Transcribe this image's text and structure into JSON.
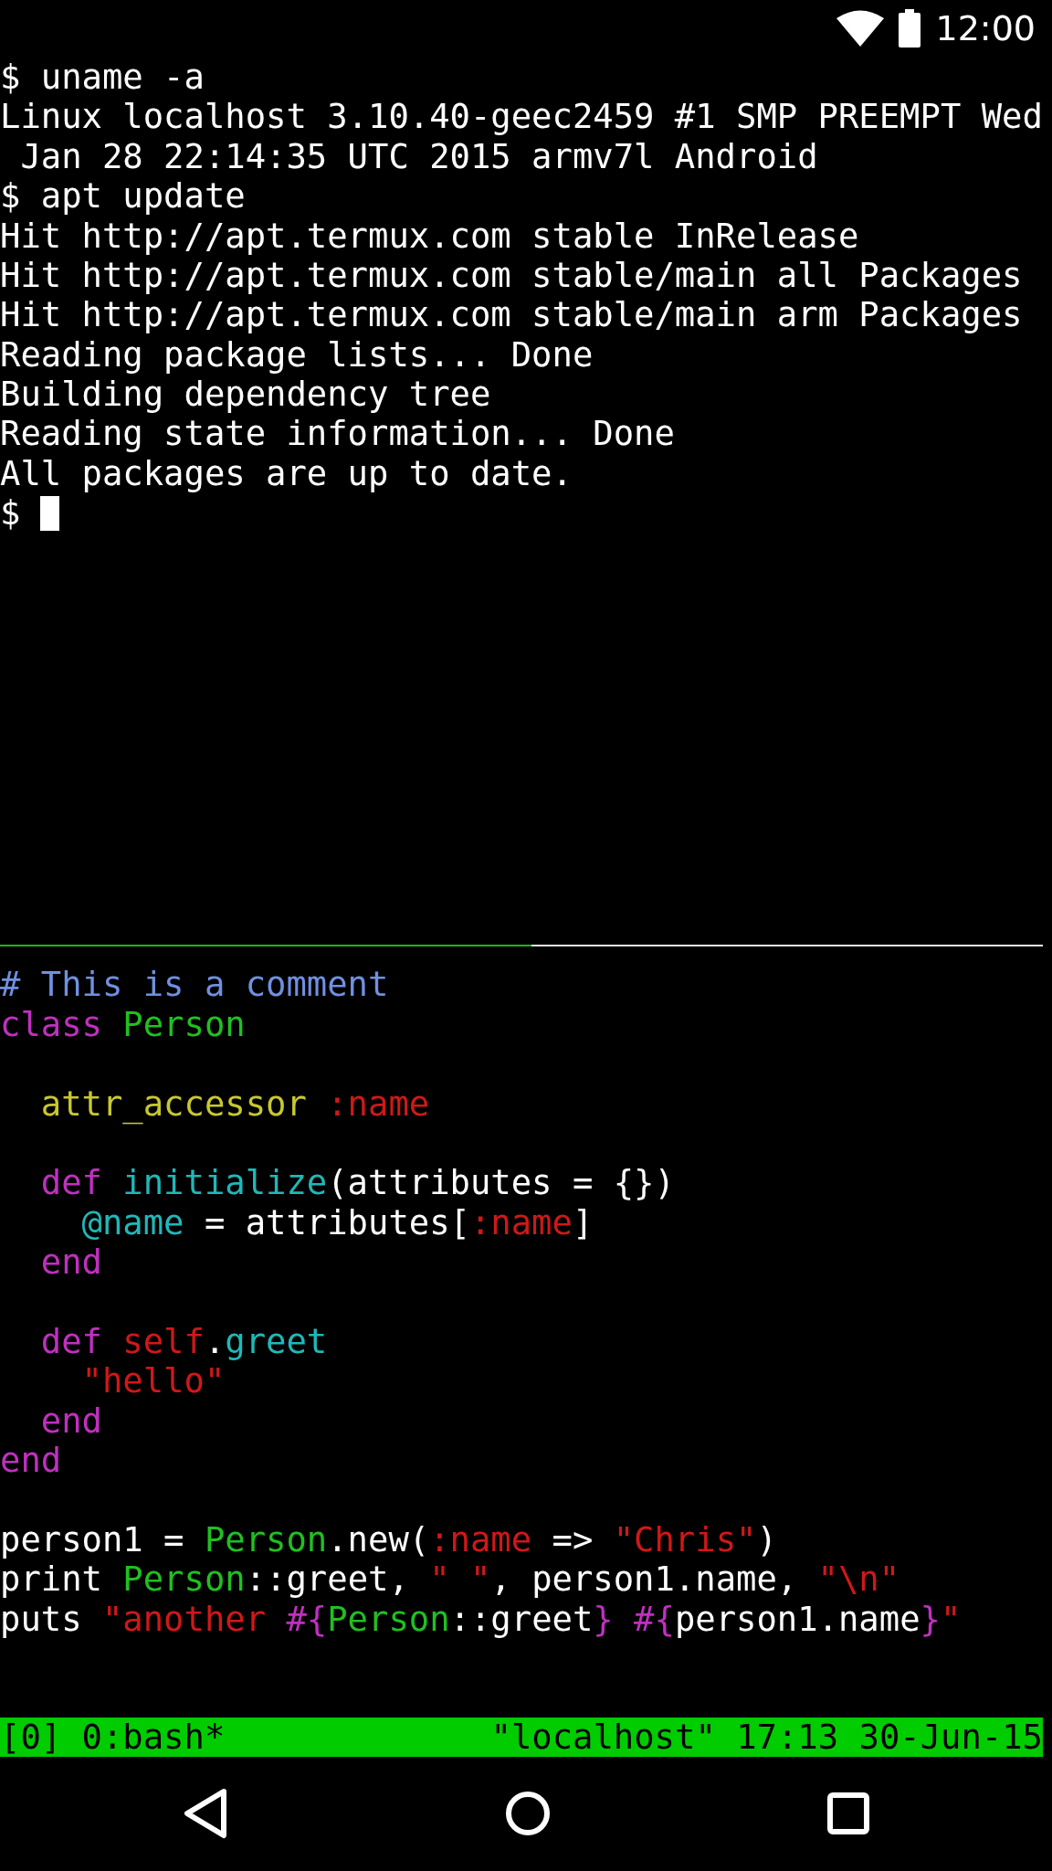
{
  "status_bar": {
    "time": "12:00"
  },
  "top_pane": {
    "lines": [
      "$ uname -a",
      "Linux localhost 3.10.40-geec2459 #1 SMP PREEMPT Wed",
      " Jan 28 22:14:35 UTC 2015 armv7l Android",
      "$ apt update",
      "Hit http://apt.termux.com stable InRelease",
      "Hit http://apt.termux.com stable/main all Packages",
      "Hit http://apt.termux.com stable/main arm Packages",
      "Reading package lists... Done",
      "Building dependency tree",
      "Reading state information... Done",
      "All packages are up to date."
    ],
    "prompt": {
      "text": "$",
      "cursor": true
    }
  },
  "divider": {
    "level": 0.51
  },
  "code_pane": {
    "lines": [
      {
        "kind": "code",
        "segments": [
          {
            "text": "# This is a comment",
            "color": "#7090e0"
          }
        ]
      },
      {
        "kind": "code",
        "segments": [
          {
            "text": "class ",
            "color": "#c030c0"
          },
          {
            "text": "Person",
            "color": "#20c020"
          }
        ]
      },
      {
        "kind": "blank"
      },
      {
        "kind": "code",
        "segments": [
          {
            "text": "  attr_accessor ",
            "color": "#c8c830"
          },
          {
            "text": ":name",
            "color": "#d01818"
          }
        ]
      },
      {
        "kind": "blank"
      },
      {
        "kind": "code",
        "segments": [
          {
            "text": "  def ",
            "color": "#c030c0"
          },
          {
            "text": "initialize",
            "color": "#20b8b8"
          },
          {
            "text": "(attributes = {})",
            "color": "#ffffff"
          }
        ]
      },
      {
        "kind": "code",
        "segments": [
          {
            "text": "    @name",
            "color": "#20b8b8"
          },
          {
            "text": " = attributes[",
            "color": "#ffffff"
          },
          {
            "text": ":name",
            "color": "#d01818"
          },
          {
            "text": "]",
            "color": "#ffffff"
          }
        ]
      },
      {
        "kind": "code",
        "segments": [
          {
            "text": "  end",
            "color": "#c030c0"
          }
        ]
      },
      {
        "kind": "blank"
      },
      {
        "kind": "code",
        "segments": [
          {
            "text": "  def ",
            "color": "#c030c0"
          },
          {
            "text": "self",
            "color": "#d01818"
          },
          {
            "text": ".",
            "color": "#ffffff"
          },
          {
            "text": "greet",
            "color": "#20b8b8"
          }
        ]
      },
      {
        "kind": "code",
        "segments": [
          {
            "text": "    \"hello\"",
            "color": "#d01818"
          }
        ]
      },
      {
        "kind": "code",
        "segments": [
          {
            "text": "  end",
            "color": "#c030c0"
          }
        ]
      },
      {
        "kind": "code",
        "segments": [
          {
            "text": "end",
            "color": "#c030c0"
          }
        ]
      },
      {
        "kind": "blank"
      },
      {
        "kind": "code",
        "segments": [
          {
            "text": "person1 = ",
            "color": "#ffffff"
          },
          {
            "text": "Person",
            "color": "#20c020"
          },
          {
            "text": ".new(",
            "color": "#ffffff"
          },
          {
            "text": ":name",
            "color": "#d01818"
          },
          {
            "text": " => ",
            "color": "#ffffff"
          },
          {
            "text": "\"Chris\"",
            "color": "#d01818"
          },
          {
            "text": ")",
            "color": "#ffffff"
          }
        ]
      },
      {
        "kind": "code",
        "segments": [
          {
            "text": "print ",
            "color": "#ffffff"
          },
          {
            "text": "Person",
            "color": "#20c020"
          },
          {
            "text": "::greet, ",
            "color": "#ffffff"
          },
          {
            "text": "\" \"",
            "color": "#d01818"
          },
          {
            "text": ", person1.name, ",
            "color": "#ffffff"
          },
          {
            "text": "\"\\n\"",
            "color": "#d01818"
          }
        ]
      },
      {
        "kind": "code",
        "segments": [
          {
            "text": "puts ",
            "color": "#ffffff"
          },
          {
            "text": "\"another ",
            "color": "#d01818"
          },
          {
            "text": "#{",
            "color": "#c030c0"
          },
          {
            "text": "Person",
            "color": "#20c020"
          },
          {
            "text": "::greet",
            "color": "#ffffff"
          },
          {
            "text": "} #{",
            "color": "#c030c0"
          },
          {
            "text": "person1.name",
            "color": "#ffffff"
          },
          {
            "text": "}",
            "color": "#c030c0"
          },
          {
            "text": "\"",
            "color": "#d01818"
          }
        ]
      }
    ]
  },
  "tmux_status": {
    "left": "[0] 0:bash*",
    "right": "\"localhost\" 17:13 30-Jun-15"
  }
}
